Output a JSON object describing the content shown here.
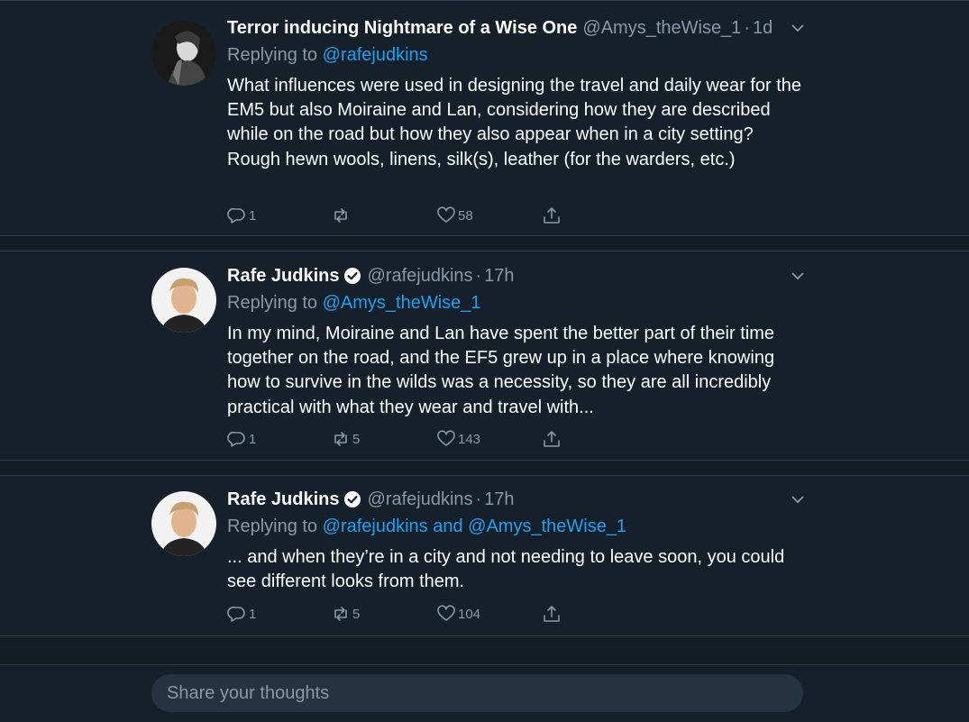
{
  "tweets": [
    {
      "name": "Terror inducing Nightmare of a Wise One",
      "handle": "@Amys_theWise_1",
      "dot": "·",
      "time": "1d",
      "verified": false,
      "replying_prefix": "Replying to ",
      "replying_to": "@rafejudkins",
      "replying_conj": "",
      "replying_to_2": "",
      "text": "What influences were used in designing the travel and daily wear for the EM5 but also Moiraine and Lan, considering how they are described while on the road but how they also appear when in a city setting? Rough hewn wools, linens, silk(s), leather (for the warders, etc.)",
      "replies": "1",
      "retweets": "",
      "likes": "58"
    },
    {
      "name": "Rafe Judkins",
      "handle": "@rafejudkins",
      "dot": "·",
      "time": "17h",
      "verified": true,
      "replying_prefix": "Replying to ",
      "replying_to": "@Amys_theWise_1",
      "replying_conj": "",
      "replying_to_2": "",
      "text": "In my mind, Moiraine and Lan have spent the better part of their time together on the road, and the EF5 grew up in a place where knowing how to survive in the wilds was a necessity, so they are all incredibly practical with what they wear and travel with...",
      "replies": "1",
      "retweets": "5",
      "likes": "143"
    },
    {
      "name": "Rafe Judkins",
      "handle": "@rafejudkins",
      "dot": "·",
      "time": "17h",
      "verified": true,
      "replying_prefix": "Replying to ",
      "replying_to": "@rafejudkins",
      "replying_conj": " and ",
      "replying_to_2": "@Amys_theWise_1",
      "text": "... and when they’re in a city and not needing to leave soon, you could see different looks from them.",
      "replies": "1",
      "retweets": "5",
      "likes": "104"
    }
  ],
  "composer": {
    "placeholder": "Share your thoughts"
  },
  "colors": {
    "background": "#15202b",
    "secondary_text": "#8899a6",
    "accent": "#1da1f2"
  }
}
